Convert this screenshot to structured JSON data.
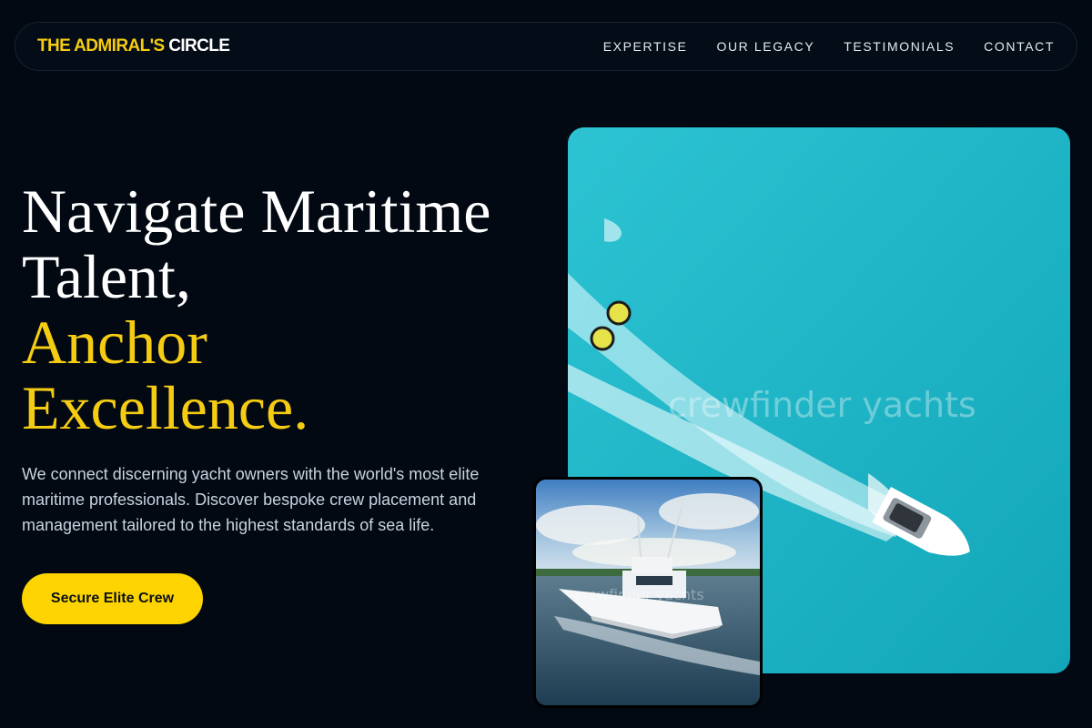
{
  "nav": {
    "logo_part1": "THE ADMIRAL'S",
    "logo_part2": "CIRCLE",
    "links": [
      "EXPERTISE",
      "OUR LEGACY",
      "TESTIMONIALS",
      "CONTACT"
    ]
  },
  "hero": {
    "title_line1": "Navigate Maritime",
    "title_line2": "Talent,",
    "title_line3": "Anchor",
    "title_line4": "Excellence.",
    "description": "We connect discerning yacht owners with the world's most elite maritime professionals. Discover bespoke crew placement and management tailored to the highest standards of sea life.",
    "cta_label": "Secure Elite Crew"
  },
  "images": {
    "main_watermark": "crewfinder yachts",
    "small_watermark": "crewfinder yachts"
  },
  "colors": {
    "background": "#020913",
    "accent": "#f5cc12",
    "cta": "#fdd400"
  }
}
